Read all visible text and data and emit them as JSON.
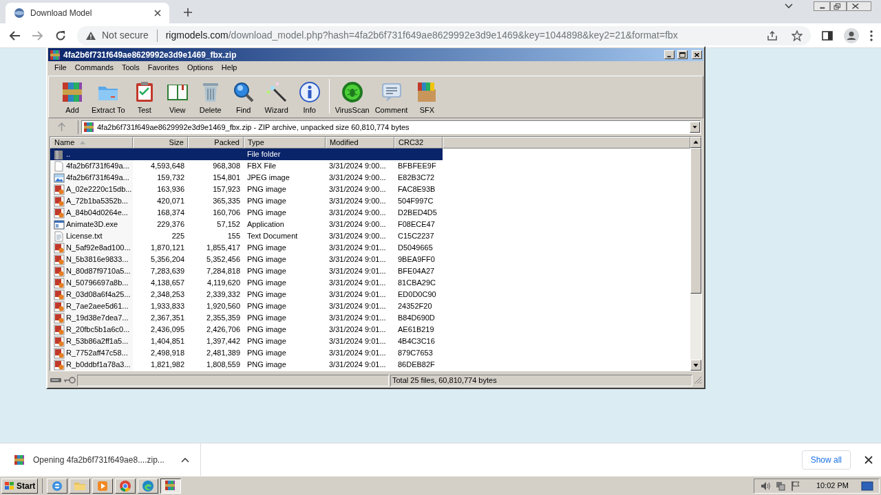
{
  "browser": {
    "tab": {
      "title": "Download Model"
    },
    "security": "Not secure",
    "url": {
      "host": "rigmodels.com",
      "path": "/download_model.php?hash=4fa2b6f731f649ae8629992e3d9e1469&key=1044898&key2=21&format=fbx"
    }
  },
  "window": {
    "title": "4fa2b6f731f649ae8629992e3d9e1469_fbx.zip"
  },
  "menu": [
    "File",
    "Commands",
    "Tools",
    "Favorites",
    "Options",
    "Help"
  ],
  "toolbar": [
    "Add",
    "Extract To",
    "Test",
    "View",
    "Delete",
    "Find",
    "Wizard",
    "Info",
    "VirusScan",
    "Comment",
    "SFX"
  ],
  "path": "4fa2b6f731f649ae8629992e3d9e1469_fbx.zip - ZIP archive, unpacked size 60,810,774 bytes",
  "columns": [
    "Name",
    "Size",
    "Packed",
    "Type",
    "Modified",
    "CRC32"
  ],
  "rows": [
    {
      "kind": "folder",
      "name": "..",
      "size": "",
      "packed": "",
      "type": "File folder",
      "modified": "",
      "crc": "",
      "selected": true
    },
    {
      "kind": "file",
      "name": "4fa2b6f731f649a...",
      "size": "4,593,648",
      "packed": "968,308",
      "type": "FBX File",
      "modified": "3/31/2024 9:00...",
      "crc": "BFBFEE9F",
      "selected": false
    },
    {
      "kind": "jpeg",
      "name": "4fa2b6f731f649a...",
      "size": "159,732",
      "packed": "154,801",
      "type": "JPEG image",
      "modified": "3/31/2024 9:00...",
      "crc": "E82B3C72",
      "selected": false
    },
    {
      "kind": "png",
      "name": "A_02e2220c15db...",
      "size": "163,936",
      "packed": "157,923",
      "type": "PNG image",
      "modified": "3/31/2024 9:00...",
      "crc": "FAC8E93B",
      "selected": false
    },
    {
      "kind": "png",
      "name": "A_72b1ba5352b...",
      "size": "420,071",
      "packed": "365,335",
      "type": "PNG image",
      "modified": "3/31/2024 9:00...",
      "crc": "504F997C",
      "selected": false
    },
    {
      "kind": "png",
      "name": "A_84b04d0264e...",
      "size": "168,374",
      "packed": "160,706",
      "type": "PNG image",
      "modified": "3/31/2024 9:00...",
      "crc": "D2BED4D5",
      "selected": false
    },
    {
      "kind": "exe",
      "name": "Animate3D.exe",
      "size": "229,376",
      "packed": "57,152",
      "type": "Application",
      "modified": "3/31/2024 9:00...",
      "crc": "F08ECE47",
      "selected": false
    },
    {
      "kind": "text",
      "name": "License.txt",
      "size": "225",
      "packed": "155",
      "type": "Text Document",
      "modified": "3/31/2024 9:00...",
      "crc": "C15C2237",
      "selected": false
    },
    {
      "kind": "png",
      "name": "N_5af92e8ad100...",
      "size": "1,870,121",
      "packed": "1,855,417",
      "type": "PNG image",
      "modified": "3/31/2024 9:01...",
      "crc": "D5049665",
      "selected": false
    },
    {
      "kind": "png",
      "name": "N_5b3816e9833...",
      "size": "5,356,204",
      "packed": "5,352,456",
      "type": "PNG image",
      "modified": "3/31/2024 9:01...",
      "crc": "9BEA9FF0",
      "selected": false
    },
    {
      "kind": "png",
      "name": "N_80d87f9710a5...",
      "size": "7,283,639",
      "packed": "7,284,818",
      "type": "PNG image",
      "modified": "3/31/2024 9:01...",
      "crc": "BFE04A27",
      "selected": false
    },
    {
      "kind": "png",
      "name": "N_50796697a8b...",
      "size": "4,138,657",
      "packed": "4,119,620",
      "type": "PNG image",
      "modified": "3/31/2024 9:01...",
      "crc": "81CBA29C",
      "selected": false
    },
    {
      "kind": "png",
      "name": "R_03d08a6f4a25...",
      "size": "2,348,253",
      "packed": "2,339,332",
      "type": "PNG image",
      "modified": "3/31/2024 9:01...",
      "crc": "ED0D0C90",
      "selected": false
    },
    {
      "kind": "png",
      "name": "R_7ae2aee5d61...",
      "size": "1,933,833",
      "packed": "1,920,560",
      "type": "PNG image",
      "modified": "3/31/2024 9:01...",
      "crc": "24352F20",
      "selected": false
    },
    {
      "kind": "png",
      "name": "R_19d38e7dea7...",
      "size": "2,367,351",
      "packed": "2,355,359",
      "type": "PNG image",
      "modified": "3/31/2024 9:01...",
      "crc": "B84D690D",
      "selected": false
    },
    {
      "kind": "png",
      "name": "R_20fbc5b1a6c0...",
      "size": "2,436,095",
      "packed": "2,426,706",
      "type": "PNG image",
      "modified": "3/31/2024 9:01...",
      "crc": "AE61B219",
      "selected": false
    },
    {
      "kind": "png",
      "name": "R_53b86a2ff1a5...",
      "size": "1,404,851",
      "packed": "1,397,442",
      "type": "PNG image",
      "modified": "3/31/2024 9:01...",
      "crc": "4B4C3C16",
      "selected": false
    },
    {
      "kind": "png",
      "name": "R_7752aff47c58...",
      "size": "2,498,918",
      "packed": "2,481,389",
      "type": "PNG image",
      "modified": "3/31/2024 9:01...",
      "crc": "879C7653",
      "selected": false
    },
    {
      "kind": "png",
      "name": "R_b0ddbf1a78a3...",
      "size": "1,821,982",
      "packed": "1,808,559",
      "type": "PNG image",
      "modified": "3/31/2024 9:01...",
      "crc": "86DEB82F",
      "selected": false
    }
  ],
  "status": "Total 25 files, 60,810,774 bytes",
  "download": {
    "text": "Opening 4fa2b6f731f649ae8....zip...",
    "show_all": "Show all"
  },
  "taskbar": {
    "start": "Start",
    "clock": "10:02 PM"
  }
}
